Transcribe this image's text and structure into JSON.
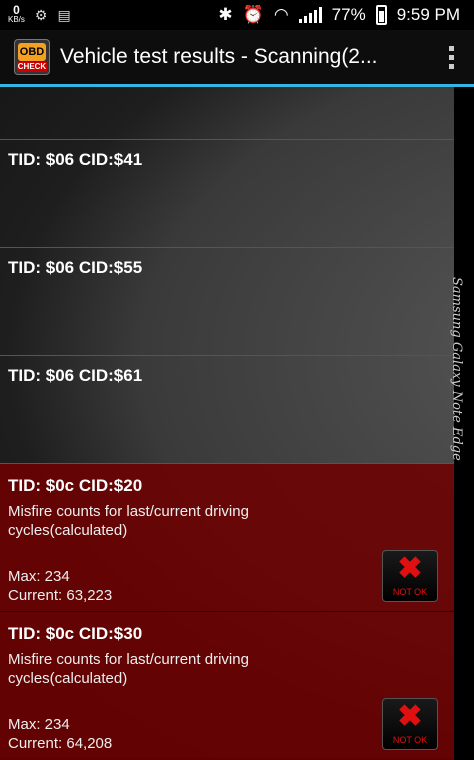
{
  "status_bar": {
    "kbs_value": "0",
    "kbs_unit": "KB/s",
    "battery": "77%",
    "time": "9:59 PM"
  },
  "action_bar": {
    "logo_top": "OBD",
    "logo_bottom": "CHECK",
    "title": "Vehicle test results - Scanning(2..."
  },
  "results": [
    {
      "tid": "TID: $06 CID:$41"
    },
    {
      "tid": "TID: $06 CID:$55"
    },
    {
      "tid": "TID: $06 CID:$61"
    },
    {
      "tid": "TID: $0c CID:$20",
      "description": "Misfire counts for last/current driving cycles(calculated)",
      "max": "Max: 234",
      "current": "Current: 63,223",
      "status": "NOT OK"
    },
    {
      "tid": "TID: $0c CID:$30",
      "description": "Misfire counts for last/current driving cycles(calculated)",
      "max": "Max: 234",
      "current": "Current: 64,208",
      "status": "NOT OK"
    }
  ],
  "edge_label": "Samsung Galaxy Note Edge",
  "colors": {
    "accent": "#33b5e5",
    "fail_row": "#6e0000",
    "not_ok": "#e01010"
  }
}
